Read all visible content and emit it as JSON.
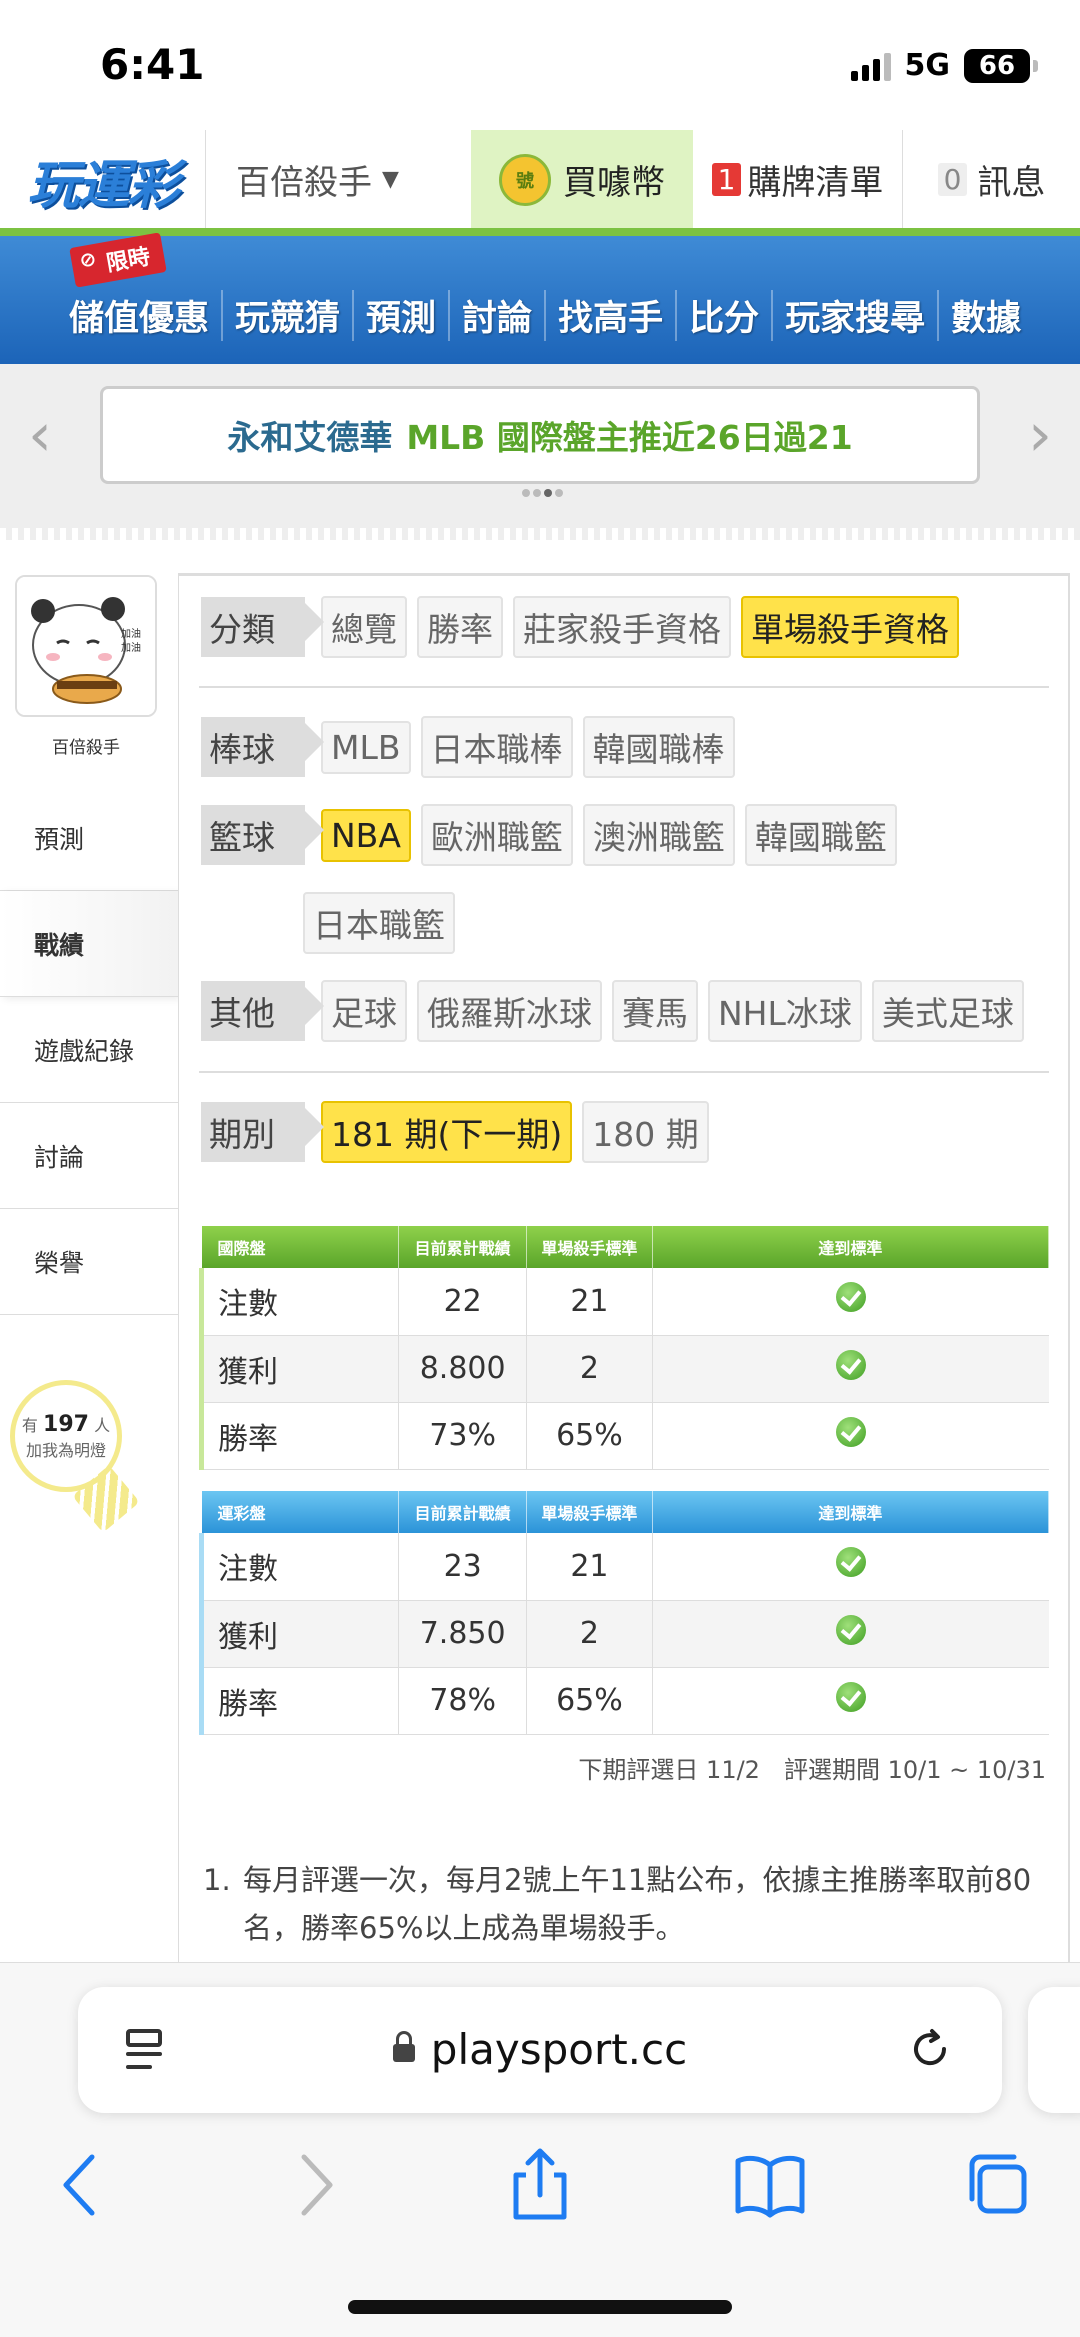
{
  "status": {
    "time": "6:41",
    "network": "5G",
    "battery": "66"
  },
  "topnav": {
    "logo": "玩運彩",
    "user": "百倍殺手",
    "coin_icon_text": "號",
    "buy_coin": "買噱幣",
    "cart_count": "1",
    "cart_label": "購牌清單",
    "msg_count": "0",
    "msg_label": "訊息"
  },
  "bluebar": {
    "limited": "限時",
    "items": [
      "儲值優惠",
      "玩競猜",
      "預測",
      "討論",
      "找高手",
      "比分",
      "玩家搜尋",
      "數據"
    ]
  },
  "banner": {
    "text_part1": "永和艾德華",
    "text_part2": "MLB 國際盤主推近26日過21"
  },
  "sidebar": {
    "username": "百倍殺手",
    "items": [
      "預測",
      "戰績",
      "遊戲紀錄",
      "討論",
      "榮譽"
    ],
    "active": "戰績",
    "bulb_prefix": "有",
    "bulb_count": "197",
    "bulb_suffix": "人",
    "bulb_text": "加我為明燈"
  },
  "filters": {
    "category": {
      "label": "分類",
      "tags": [
        "總覽",
        "勝率",
        "莊家殺手資格",
        "單場殺手資格"
      ],
      "selected": "單場殺手資格"
    },
    "baseball": {
      "label": "棒球",
      "tags": [
        "MLB",
        "日本職棒",
        "韓國職棒"
      ]
    },
    "basketball": {
      "label": "籃球",
      "tags": [
        "NBA",
        "歐洲職籃",
        "澳洲職籃",
        "韓國職籃",
        "日本職籃"
      ],
      "selected": "NBA"
    },
    "other": {
      "label": "其他",
      "tags": [
        "足球",
        "俄羅斯冰球",
        "賽馬",
        "NHL冰球",
        "美式足球"
      ]
    },
    "period": {
      "label": "期別",
      "tags": [
        "181 期(下一期)",
        "180 期"
      ],
      "selected": "181 期(下一期)"
    }
  },
  "international_table": {
    "headers": [
      "國際盤",
      "目前累計戰績",
      "單場殺手標準",
      "達到標準"
    ],
    "rows": [
      {
        "label": "注數",
        "current": "22",
        "standard": "21"
      },
      {
        "label": "獲利",
        "current": "8.800",
        "standard": "2"
      },
      {
        "label": "勝率",
        "current": "73%",
        "standard": "65%"
      }
    ]
  },
  "lottery_table": {
    "headers": [
      "運彩盤",
      "目前累計戰績",
      "單場殺手標準",
      "達到標準"
    ],
    "rows": [
      {
        "label": "注數",
        "current": "23",
        "standard": "21"
      },
      {
        "label": "獲利",
        "current": "7.850",
        "standard": "2"
      },
      {
        "label": "勝率",
        "current": "78%",
        "standard": "65%"
      }
    ]
  },
  "period_note": "下期評選日 11/2　評選期間 10/1 ~ 10/31",
  "notes": [
    {
      "num": "1.",
      "text": "每月評選一次，每月2號上午11點公布，依據主推勝率取前80名，勝率65%以上成為單場殺手。"
    }
  ],
  "safari": {
    "url": "playsport.cc"
  },
  "colors": {
    "green_header": "#5aa52a",
    "blue_header": "#2b93d8",
    "selected_tag": "#ffe24a",
    "nav_blue": "#1c64b8"
  }
}
